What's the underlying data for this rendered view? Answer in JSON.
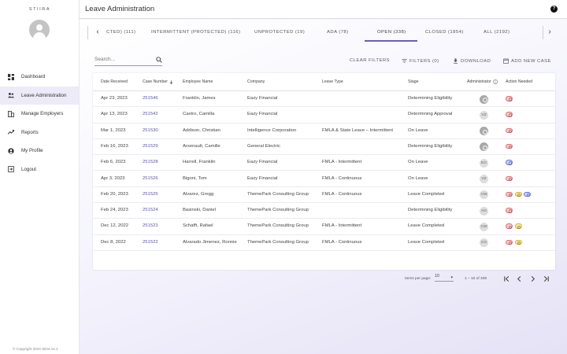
{
  "sidebar": {
    "brand": "STIIRA",
    "items": [
      {
        "label": "Dashboard",
        "icon": "dashboard-icon"
      },
      {
        "label": "Leave Administration",
        "icon": "people-icon",
        "active": true
      },
      {
        "label": "Manage Employers",
        "icon": "building-icon"
      },
      {
        "label": "Reports",
        "icon": "trend-icon"
      },
      {
        "label": "My Profile",
        "icon": "account-icon"
      },
      {
        "label": "Logout",
        "icon": "logout-icon"
      }
    ],
    "copyright": "© Copyright 2024 Stiira v4.1"
  },
  "header": {
    "title": "Leave Administration",
    "help_icon": "help-icon"
  },
  "tabs": [
    {
      "label": "CTED) (111)"
    },
    {
      "label": "INTERMITTENT (PROTECTED) (116)"
    },
    {
      "label": "UNPROTECTED (19)"
    },
    {
      "label": "ADA (78)"
    },
    {
      "label": "OPEN (338)",
      "active": true
    },
    {
      "label": "CLOSED (1854)"
    },
    {
      "label": "ALL (2192)"
    }
  ],
  "toolbar": {
    "search_placeholder": "Search...",
    "clear_filters": "CLEAR FILTERS",
    "filters": "FILTERS (0)",
    "download": "DOWNLOAD",
    "add_new_case": "ADD NEW CASE"
  },
  "table": {
    "columns": [
      "Date Received",
      "Case Number",
      "Employee Name",
      "Company",
      "Leave Type",
      "Stage",
      "Administrator",
      "Action Needed"
    ],
    "rows": [
      {
        "date": "Apr 23, 2023",
        "case": "251546",
        "employee": "Franklin, James",
        "company": "Eazy Financial",
        "leave_type": "",
        "stage": "Determining Eligibility",
        "admin": "",
        "actions": [
          "red"
        ]
      },
      {
        "date": "Apr 13, 2023",
        "case": "251542",
        "employee": "Castro, Camilla",
        "company": "Eazy Financial",
        "leave_type": "",
        "stage": "Determining Approval",
        "admin": "VZ",
        "actions": [
          "red"
        ]
      },
      {
        "date": "Mar 1, 2023",
        "case": "251530",
        "employee": "Addison, Christian",
        "company": "Intelligence Corporation",
        "leave_type": "FMLA & State Leave – Intermittent",
        "stage": "On Leave",
        "admin": "",
        "actions": [
          "red"
        ]
      },
      {
        "date": "Feb 16, 2023",
        "case": "251529",
        "employee": "Arsenault, Camille",
        "company": "General Electric",
        "leave_type": "",
        "stage": "Determining Eligibility",
        "admin": "",
        "actions": [
          "red"
        ]
      },
      {
        "date": "Feb 6, 2023",
        "case": "251528",
        "employee": "Harrell, Franklin",
        "company": "Eazy Financial",
        "leave_type": "FMLA - Intermittent",
        "stage": "On Leave",
        "admin": "EG",
        "actions": [
          "blue"
        ]
      },
      {
        "date": "Apr 3, 2023",
        "case": "251526",
        "employee": "Bigoni, Tom",
        "company": "Eazy Financial",
        "leave_type": "FMLA - Continuous",
        "stage": "On Leave",
        "admin": "VZ",
        "actions": [
          "red"
        ]
      },
      {
        "date": "Feb 20, 2023",
        "case": "251525",
        "employee": "Alvarez, Gregg",
        "company": "ThemePark Consulting Group",
        "leave_type": "FMLA - Continuous",
        "stage": "Leave Completed",
        "admin": "CW",
        "actions": [
          "red",
          "yellow",
          "blue"
        ]
      },
      {
        "date": "Feb 24, 2023",
        "case": "251524",
        "employee": "Basinski, Daniel",
        "company": "ThemePark Consulting Group",
        "leave_type": "",
        "stage": "Determining Eligibility",
        "admin": "AG",
        "actions": [
          "red"
        ]
      },
      {
        "date": "Dec 12, 2022",
        "case": "251523",
        "employee": "Schafft, Rafael",
        "company": "ThemePark Consulting Group",
        "leave_type": "FMLA - Intermittent",
        "stage": "Leave Completed",
        "admin": "CW",
        "actions": [
          "red",
          "yellow"
        ]
      },
      {
        "date": "Dec 8, 2022",
        "case": "251522",
        "employee": "Alvarado Jimenez, Ronnie",
        "company": "ThemePark Consulting Group",
        "leave_type": "FMLA - Continuous",
        "stage": "Leave Completed",
        "admin": "CG",
        "actions": [
          "red",
          "yellow"
        ]
      }
    ]
  },
  "pagination": {
    "items_per_page_label": "Items per page:",
    "items_per_page": "10",
    "range": "1 – 10 of 338"
  },
  "colors": {
    "accent": "#6b5fb6",
    "case_link": "#5b57a6",
    "action_red": "#e66a78",
    "action_blue": "#6577de",
    "action_yellow": "#d6b52a"
  }
}
